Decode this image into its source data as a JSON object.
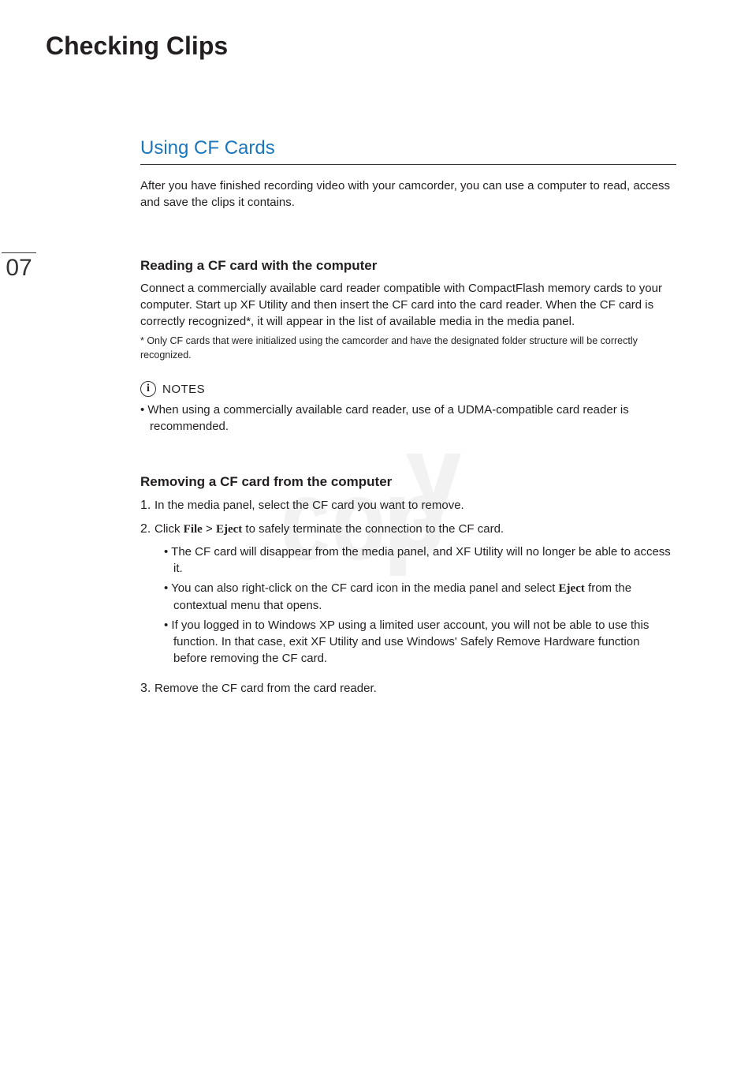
{
  "pageTitle": "Checking Clips",
  "pageNumber": "07",
  "sectionTitle": "Using CF Cards",
  "intro": "After you have finished recording video with your camcorder, you can use a computer to read, access and save the clips it contains.",
  "sub1": {
    "title": "Reading a CF card with the computer",
    "body": "Connect a commercially available card reader compatible with CompactFlash memory cards to your computer. Start up XF Utility and then insert the CF card into the card reader. When the CF card is correctly recognized*, it will appear in the list of available media in the media panel.",
    "footnote": "* Only CF cards that were initialized using the camcorder and have the designated folder structure will be correctly recognized."
  },
  "notes": {
    "label": "NOTES",
    "infoGlyph": "i",
    "item": "When using a commercially available card reader, use of a UDMA-compatible card reader is recommended."
  },
  "sub2": {
    "title": "Removing a CF card from the computer",
    "step1": {
      "num": "1.",
      "text": "In the media panel, select the CF card you want to remove."
    },
    "step2": {
      "num": "2.",
      "pre": "Click ",
      "menu1": "File",
      "gt": " > ",
      "menu2": "Eject",
      "post": " to safely terminate the connection to the CF card.",
      "b1": "The CF card will disappear from the media panel, and XF Utility will no longer be able to access it.",
      "b2pre": "You can also right-click on the CF card icon in the media panel and select ",
      "b2menu": "Eject",
      "b2post": " from the contextual menu that opens.",
      "b3": "If you logged in to Windows XP using a limited user account, you will not be able to use this function. In that case, exit XF Utility and use Windows' Safely Remove Hardware function before removing the CF card."
    },
    "step3": {
      "num": "3.",
      "text": "Remove the CF card from the card reader."
    }
  }
}
